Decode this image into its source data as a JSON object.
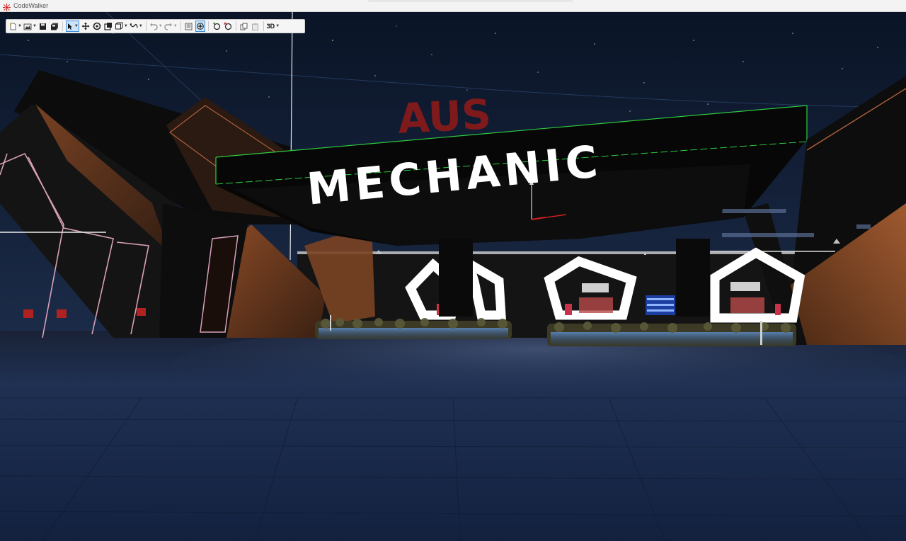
{
  "window": {
    "title": "CodeWalker"
  },
  "toolbar": {
    "buttons": [
      {
        "name": "new-button",
        "icon": "new-file-icon",
        "has_dropdown": true
      },
      {
        "name": "open-button",
        "icon": "open-folder-icon",
        "has_dropdown": true
      },
      {
        "name": "save-button",
        "icon": "save-icon",
        "has_dropdown": false
      },
      {
        "name": "save-all-button",
        "icon": "save-all-icon",
        "has_dropdown": false
      },
      {
        "name": "select-button",
        "icon": "pointer-icon",
        "has_dropdown": true,
        "active": true
      },
      {
        "name": "move-button",
        "icon": "move-icon",
        "has_dropdown": false
      },
      {
        "name": "rotate-button",
        "icon": "rotate-icon",
        "has_dropdown": false
      },
      {
        "name": "scale-button",
        "icon": "scale-icon",
        "has_dropdown": false
      },
      {
        "name": "widget-space-button",
        "icon": "widget-space-icon",
        "has_dropdown": true
      },
      {
        "name": "snap-button",
        "icon": "snap-icon",
        "has_dropdown": true
      },
      {
        "name": "undo-button",
        "icon": "undo-icon",
        "has_dropdown": true
      },
      {
        "name": "redo-button",
        "icon": "redo-icon",
        "has_dropdown": true
      },
      {
        "name": "info-button",
        "icon": "info-list-icon",
        "has_dropdown": false
      },
      {
        "name": "show-widget-button",
        "icon": "show-widget-icon",
        "has_dropdown": false,
        "active": true
      },
      {
        "name": "add-entity-button",
        "icon": "add-entity-icon",
        "has_dropdown": false
      },
      {
        "name": "delete-entity-button",
        "icon": "delete-entity-icon",
        "has_dropdown": false
      },
      {
        "name": "copy-button",
        "icon": "copy-icon",
        "has_dropdown": false
      },
      {
        "name": "paste-button",
        "icon": "paste-icon",
        "has_dropdown": false
      }
    ],
    "view_mode_label": "3D"
  },
  "scene": {
    "sign_top": "AUS",
    "sign_main": "MECHANIC"
  },
  "colors": {
    "sky_top": "#0a1426",
    "sky_bottom": "#1c2d4a",
    "ground": "#1a2a46",
    "sign_red": "#8b1a1a",
    "sign_white": "#ffffff",
    "selection_green": "#2ecc40",
    "accent_blue": "#3d8ee0",
    "wall_brown": "#6b3a1f",
    "neon_pink": "#d8a0b8"
  }
}
